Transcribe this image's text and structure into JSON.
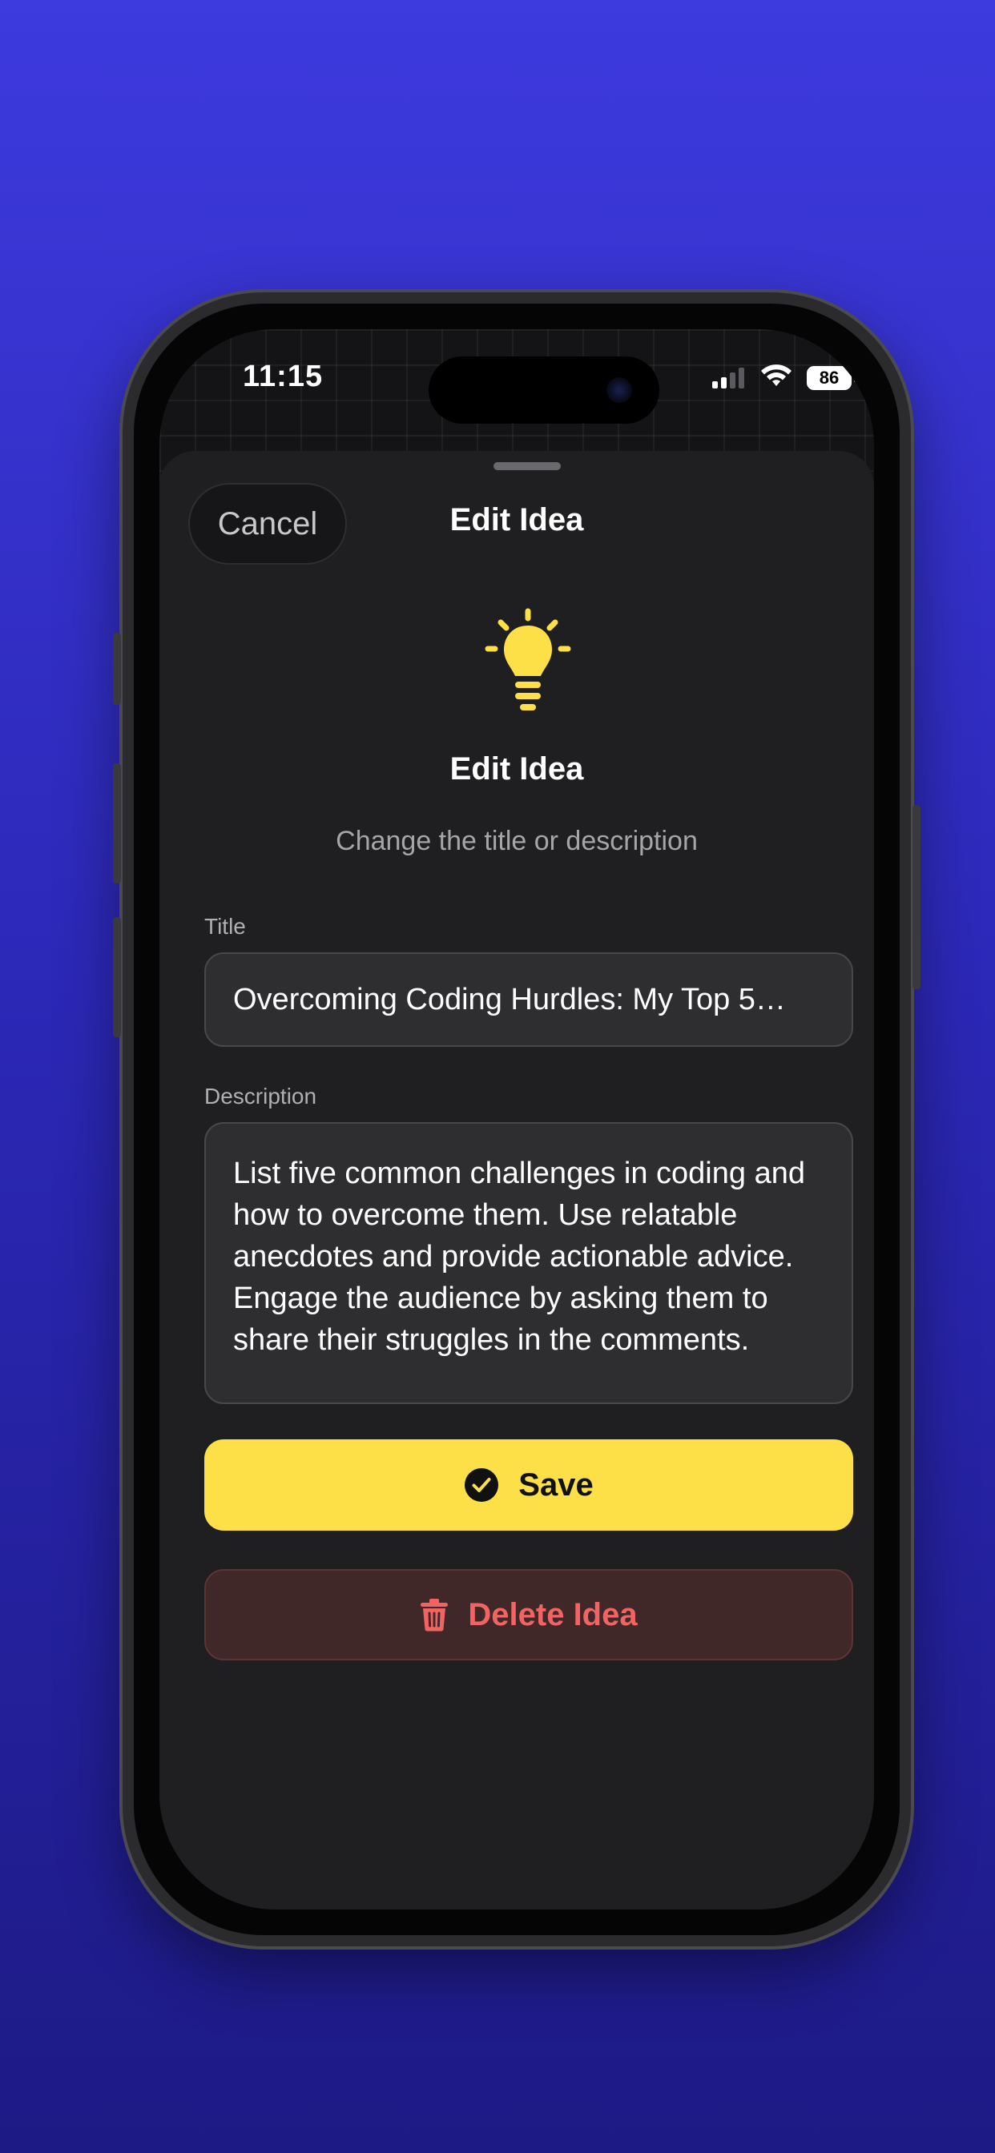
{
  "status_bar": {
    "time": "11:15",
    "battery": "86",
    "icons": [
      "signal-icon",
      "wifi-icon",
      "battery-icon"
    ]
  },
  "nav": {
    "cancel_label": "Cancel",
    "title": "Edit Idea"
  },
  "header": {
    "icon": "lightbulb-icon",
    "title": "Edit Idea",
    "subtitle": "Change the title or description"
  },
  "form": {
    "title_label": "Title",
    "title_value": "Overcoming Coding Hurdles: My Top 5…",
    "description_label": "Description",
    "description_value": "List five common challenges in coding and how to overcome them. Use relatable anecdotes and provide actionable advice. Engage the audience by asking them to share their struggles in the comments."
  },
  "actions": {
    "save_label": "Save",
    "save_icon": "checkmark-circle-icon",
    "delete_label": "Delete Idea",
    "delete_icon": "trash-icon"
  },
  "colors": {
    "background": "#3d3ade",
    "accent_yellow": "#fde047",
    "destructive_red": "#f16464",
    "sheet": "#1f1f21"
  }
}
